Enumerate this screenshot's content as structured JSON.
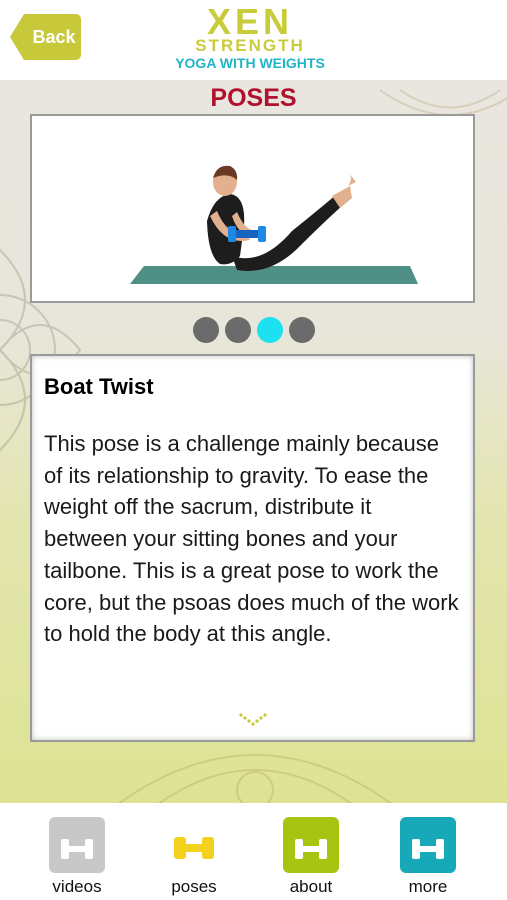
{
  "header": {
    "back_label": "Back",
    "logo_line1": "XEN",
    "logo_line2": "STRENGTH",
    "logo_line3": "YOGA WITH WEIGHTS"
  },
  "page": {
    "title": "POSES"
  },
  "carousel": {
    "total_pages": 4,
    "active_page": 3
  },
  "pose": {
    "name": "Boat Twist",
    "description": "This pose is a challenge mainly because of its relationship to gravity. To ease the weight off the sacrum, distribute it between your sitting bones and your tailbone. This is a great pose to work the core, but the psoas does much of the work to hold the body at this angle."
  },
  "nav": {
    "items": [
      {
        "label": "videos",
        "icon": "dumbbell-icon",
        "color": "#c8c8c8"
      },
      {
        "label": "poses",
        "icon": "dumbbell-icon",
        "color": "#f2d21c"
      },
      {
        "label": "about",
        "icon": "dumbbell-icon",
        "color": "#a8c412"
      },
      {
        "label": "more",
        "icon": "dumbbell-icon",
        "color": "#17a9b7"
      }
    ]
  },
  "colors": {
    "accent_green": "#c9cc3a",
    "accent_teal": "#1fb5c6",
    "title_red": "#b0122d",
    "active_dot": "#1de0f0"
  }
}
